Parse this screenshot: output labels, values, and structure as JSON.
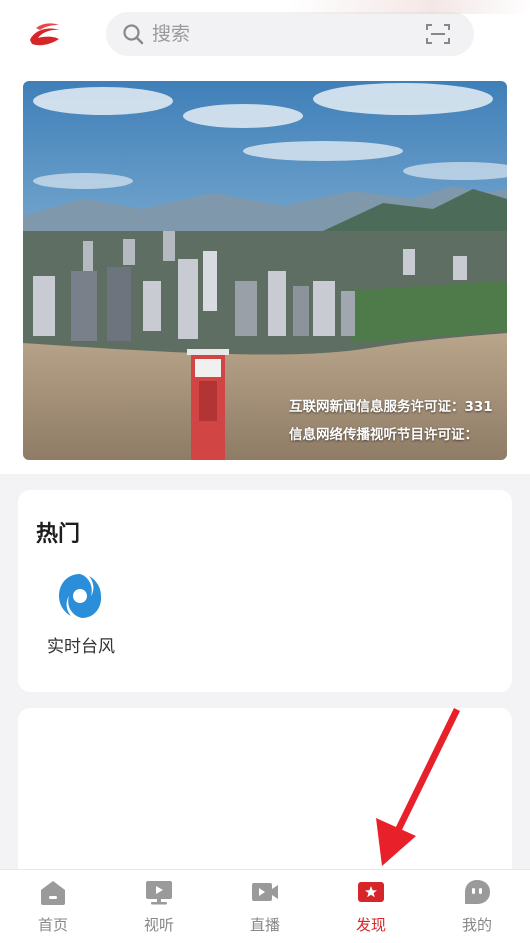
{
  "header": {
    "search_placeholder": "搜索"
  },
  "banner": {
    "caption_line1": "互联网新闻信息服务许可证：331",
    "caption_line2": "信息网络传播视听节目许可证："
  },
  "hot": {
    "title": "热门",
    "items": [
      {
        "label": "实时台风",
        "icon": "typhoon-icon"
      }
    ]
  },
  "tabbar": {
    "tabs": [
      {
        "label": "首页",
        "icon": "home-icon",
        "active": false
      },
      {
        "label": "视听",
        "icon": "tv-icon",
        "active": false
      },
      {
        "label": "直播",
        "icon": "live-video-icon",
        "active": false
      },
      {
        "label": "发现",
        "icon": "discover-star-icon",
        "active": true
      },
      {
        "label": "我的",
        "icon": "profile-icon",
        "active": false
      }
    ],
    "active_color": "#d6262a",
    "inactive_color": "#888888"
  },
  "colors": {
    "brand_red": "#d6262a",
    "typhoon_blue": "#2a8fd8"
  }
}
